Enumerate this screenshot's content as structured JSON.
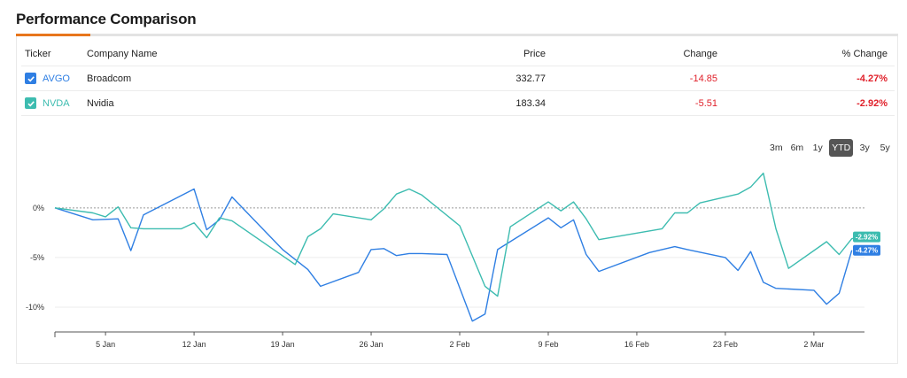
{
  "header": {
    "title": "Performance Comparison"
  },
  "table": {
    "columns": {
      "ticker": "Ticker",
      "company": "Company Name",
      "price": "Price",
      "change": "Change",
      "pct": "% Change"
    },
    "rows": [
      {
        "ticker": "AVGO",
        "company": "Broadcom",
        "price": "332.77",
        "change": "-14.85",
        "pct": "-4.27%",
        "color": "#2f7fe3"
      },
      {
        "ticker": "NVDA",
        "company": "Nvidia",
        "price": "183.34",
        "change": "-5.51",
        "pct": "-2.92%",
        "color": "#3dbcb0"
      }
    ]
  },
  "range_buttons": [
    {
      "label": "3m",
      "active": false
    },
    {
      "label": "6m",
      "active": false
    },
    {
      "label": "1y",
      "active": false
    },
    {
      "label": "YTD",
      "active": true
    },
    {
      "label": "3y",
      "active": false
    },
    {
      "label": "5y",
      "active": false
    }
  ],
  "chart_data": {
    "type": "line",
    "x_unit": "2026 calendar date",
    "xlim": [
      "2026-01-01",
      "2026-03-06"
    ],
    "ylim": [
      -12.5,
      4
    ],
    "y_ticks": [
      {
        "value": 0,
        "label": "0%"
      },
      {
        "value": -5,
        "label": "-5%"
      },
      {
        "value": -10,
        "label": "-10%"
      }
    ],
    "x_ticks": [
      {
        "date": "2026-01-05",
        "label": "5 Jan"
      },
      {
        "date": "2026-01-12",
        "label": "12 Jan"
      },
      {
        "date": "2026-01-19",
        "label": "19 Jan"
      },
      {
        "date": "2026-01-26",
        "label": "26 Jan"
      },
      {
        "date": "2026-02-02",
        "label": "2 Feb"
      },
      {
        "date": "2026-02-09",
        "label": "9 Feb"
      },
      {
        "date": "2026-02-16",
        "label": "16 Feb"
      },
      {
        "date": "2026-02-23",
        "label": "23 Feb"
      },
      {
        "date": "2026-03-02",
        "label": "2 Mar"
      }
    ],
    "zero_line": "dotted",
    "series": [
      {
        "name": "AVGO",
        "color": "#2f7fe3",
        "end_label": "-4.27%",
        "points": [
          [
            "2026-01-01",
            0
          ],
          [
            "2026-01-04",
            -1.2
          ],
          [
            "2026-01-06",
            -1.1
          ],
          [
            "2026-01-07",
            -4.3
          ],
          [
            "2026-01-08",
            -0.7
          ],
          [
            "2026-01-12",
            1.9
          ],
          [
            "2026-01-13",
            -2.2
          ],
          [
            "2026-01-14",
            -1.2
          ],
          [
            "2026-01-15",
            1.1
          ],
          [
            "2026-01-19",
            -4.2
          ],
          [
            "2026-01-21",
            -6.2
          ],
          [
            "2026-01-22",
            -7.9
          ],
          [
            "2026-01-25",
            -6.5
          ],
          [
            "2026-01-26",
            -4.2
          ],
          [
            "2026-01-27",
            -4.1
          ],
          [
            "2026-01-28",
            -4.8
          ],
          [
            "2026-01-29",
            -4.6
          ],
          [
            "2026-01-30",
            -4.6
          ],
          [
            "2026-02-01",
            -4.7
          ],
          [
            "2026-02-03",
            -11.4
          ],
          [
            "2026-02-04",
            -10.7
          ],
          [
            "2026-02-05",
            -4.2
          ],
          [
            "2026-02-09",
            -1.0
          ],
          [
            "2026-02-10",
            -2.0
          ],
          [
            "2026-02-11",
            -1.2
          ],
          [
            "2026-02-12",
            -4.7
          ],
          [
            "2026-02-13",
            -6.4
          ],
          [
            "2026-02-17",
            -4.5
          ],
          [
            "2026-02-18",
            -4.2
          ],
          [
            "2026-02-19",
            -3.9
          ],
          [
            "2026-02-20",
            -4.2
          ],
          [
            "2026-02-23",
            -5.0
          ],
          [
            "2026-02-24",
            -6.3
          ],
          [
            "2026-02-25",
            -4.4
          ],
          [
            "2026-02-26",
            -7.5
          ],
          [
            "2026-02-27",
            -8.1
          ],
          [
            "2026-03-02",
            -8.3
          ],
          [
            "2026-03-03",
            -9.7
          ],
          [
            "2026-03-04",
            -8.6
          ],
          [
            "2026-03-05",
            -4.27
          ]
        ]
      },
      {
        "name": "NVDA",
        "color": "#3dbcb0",
        "end_label": "-2.92%",
        "points": [
          [
            "2026-01-01",
            0
          ],
          [
            "2026-01-04",
            -0.5
          ],
          [
            "2026-01-05",
            -0.9
          ],
          [
            "2026-01-06",
            0.1
          ],
          [
            "2026-01-07",
            -2.0
          ],
          [
            "2026-01-08",
            -2.1
          ],
          [
            "2026-01-11",
            -2.1
          ],
          [
            "2026-01-12",
            -1.5
          ],
          [
            "2026-01-13",
            -3.0
          ],
          [
            "2026-01-14",
            -1.0
          ],
          [
            "2026-01-15",
            -1.3
          ],
          [
            "2026-01-20",
            -5.7
          ],
          [
            "2026-01-21",
            -2.9
          ],
          [
            "2026-01-22",
            -2.1
          ],
          [
            "2026-01-23",
            -0.6
          ],
          [
            "2026-01-26",
            -1.2
          ],
          [
            "2026-01-27",
            -0.1
          ],
          [
            "2026-01-28",
            1.4
          ],
          [
            "2026-01-29",
            1.9
          ],
          [
            "2026-01-30",
            1.3
          ],
          [
            "2026-02-02",
            -1.8
          ],
          [
            "2026-02-04",
            -7.9
          ],
          [
            "2026-02-05",
            -8.9
          ],
          [
            "2026-02-06",
            -1.9
          ],
          [
            "2026-02-09",
            0.6
          ],
          [
            "2026-02-10",
            -0.3
          ],
          [
            "2026-02-11",
            0.6
          ],
          [
            "2026-02-12",
            -1.1
          ],
          [
            "2026-02-13",
            -3.2
          ],
          [
            "2026-02-18",
            -2.1
          ],
          [
            "2026-02-19",
            -0.5
          ],
          [
            "2026-02-20",
            -0.5
          ],
          [
            "2026-02-21",
            0.5
          ],
          [
            "2026-02-24",
            1.4
          ],
          [
            "2026-02-25",
            2.1
          ],
          [
            "2026-02-26",
            3.5
          ],
          [
            "2026-02-27",
            -2.1
          ],
          [
            "2026-02-28",
            -6.1
          ],
          [
            "2026-03-03",
            -3.4
          ],
          [
            "2026-03-04",
            -4.7
          ],
          [
            "2026-03-05",
            -3.1
          ],
          [
            "2026-03-06",
            -2.92
          ]
        ]
      }
    ]
  }
}
